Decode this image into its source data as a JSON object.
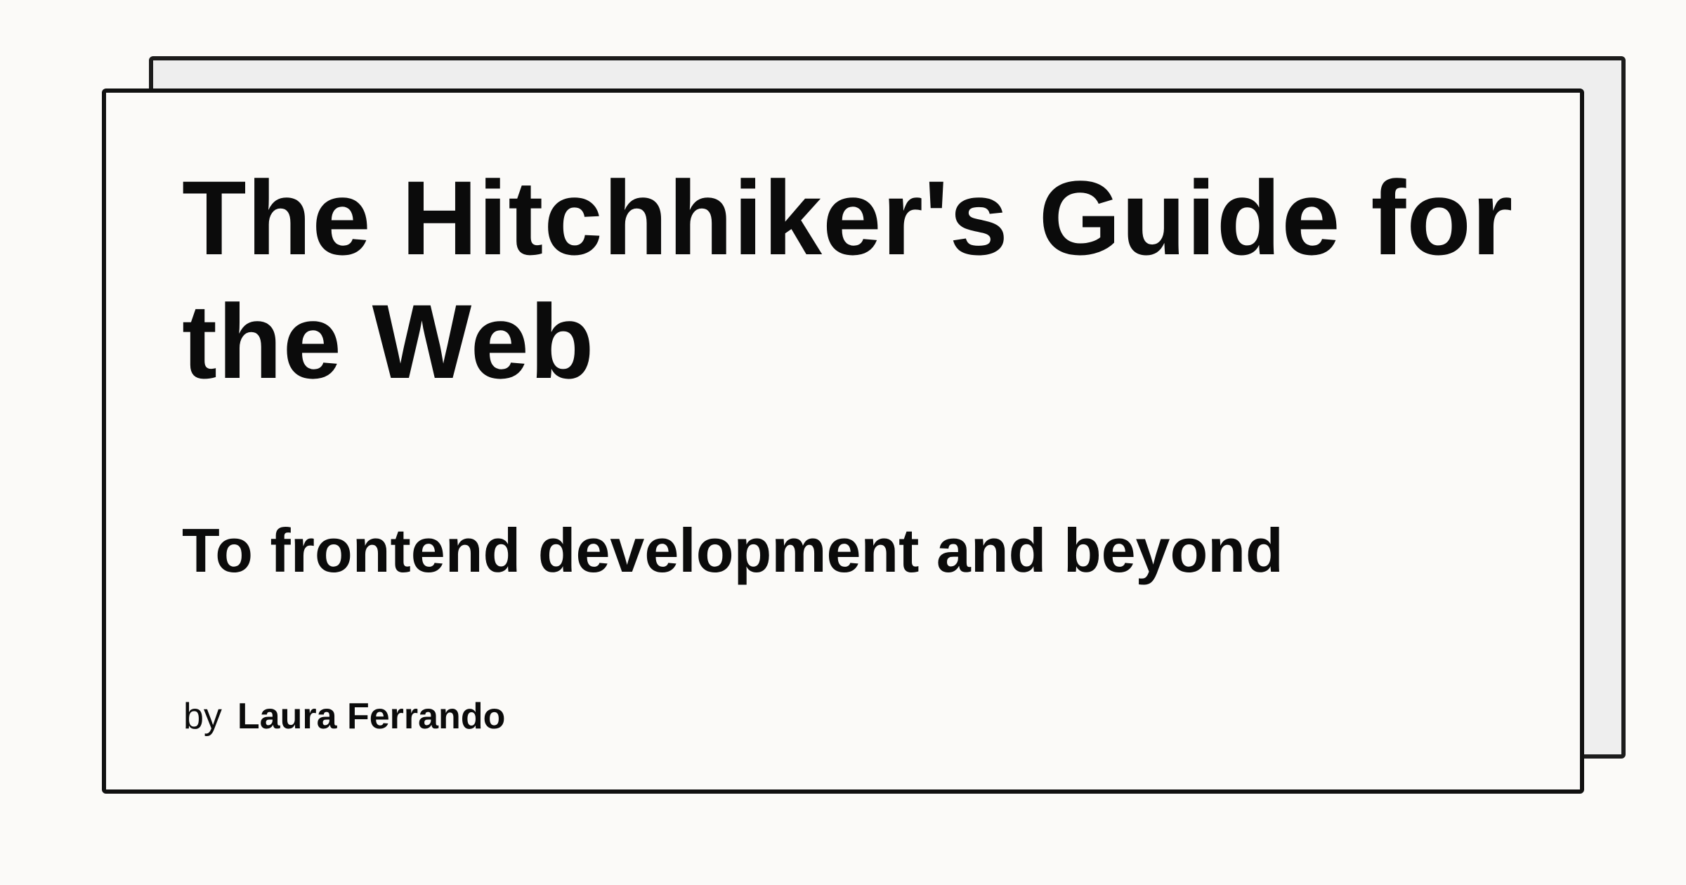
{
  "card": {
    "title": "The Hitchhiker's Guide for the Web",
    "subtitle": "To frontend development and beyond",
    "by_label": "by",
    "author": "Laura Ferrando"
  },
  "colors": {
    "background": "#fbfaf8",
    "back_card": "#eeeeee",
    "border": "#111111",
    "text": "#0b0b0b"
  }
}
